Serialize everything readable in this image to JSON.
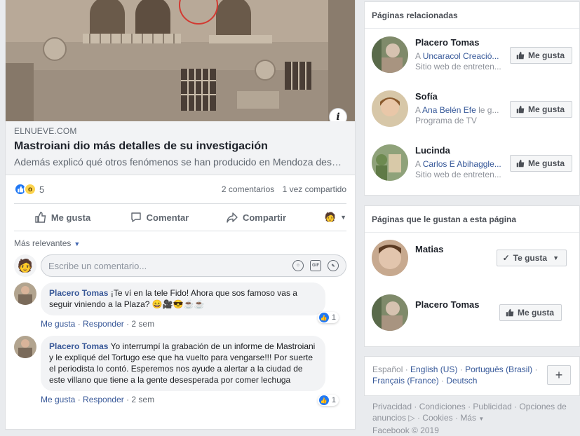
{
  "post": {
    "link": {
      "domain": "ELNUEVE.COM",
      "title": "Mastroiani dio más detalles de su investigación",
      "description": "Además explicó qué otros fenómenos se han producido en Mendoza desde..."
    },
    "info_glyph": "i",
    "reactions": {
      "count": "5"
    },
    "stats": {
      "comments": "2 comentarios",
      "shares": "1 vez compartido"
    },
    "actions": {
      "like": "Me gusta",
      "comment": "Comentar",
      "share": "Compartir"
    },
    "sort_label": "Más relevantes",
    "compose_placeholder": "Escribe un comentario...",
    "compose_icons": {
      "gif": "GIF"
    },
    "comments": [
      {
        "author": "Placero Tomas",
        "text": "¡Te ví en la tele Fido! Ahora que sos famoso vas a seguir viniendo a la Plaza? 😄🎥😎☕☕",
        "like": "Me gusta",
        "reply": "Responder",
        "time": "2 sem",
        "reactions": "1"
      },
      {
        "author": "Placero Tomas",
        "text": "Yo interrumpí la grabación de un informe de Mastroiani y le expliqué del Tortugo ese que ha vuelto para vengarse!!! Por suerte el periodista lo contó. Esperemos nos ayude a alertar a la ciudad de este villano que tiene a la gente desesperada por comer lechuga",
        "like": "Me gusta",
        "reply": "Responder",
        "time": "2 sem",
        "reactions": "1"
      }
    ]
  },
  "related": {
    "title": "Páginas relacionadas",
    "pages": [
      {
        "name": "Placero Tomas",
        "prefix": "A",
        "friend": "Uncaracol Creació...",
        "category": "Sitio web de entreten...",
        "button": "Me gusta"
      },
      {
        "name": "Sofía",
        "prefix": "A",
        "friend": "Ana Belén Efe",
        "suffix": "le g...",
        "category": "Programa de TV",
        "button": "Me gusta"
      },
      {
        "name": "Lucinda",
        "prefix": "A",
        "friend": "Carlos E Abihaggle...",
        "category": "Sitio web de entreten...",
        "button": "Me gusta"
      }
    ]
  },
  "liked_by_page": {
    "title": "Páginas que le gustan a esta página",
    "pages": [
      {
        "name": "Matias",
        "button": "Te gusta"
      },
      {
        "name": "Placero Tomas",
        "button": "Me gusta"
      }
    ]
  },
  "languages": {
    "items": [
      "Español",
      "English (US)",
      "Português (Brasil)",
      "Français (France)",
      "Deutsch"
    ],
    "plus": "+"
  },
  "legal": {
    "items": [
      "Privacidad",
      "Condiciones",
      "Publicidad",
      "Opciones de anuncios",
      "Cookies",
      "Más"
    ],
    "copyright": "Facebook © 2019"
  }
}
